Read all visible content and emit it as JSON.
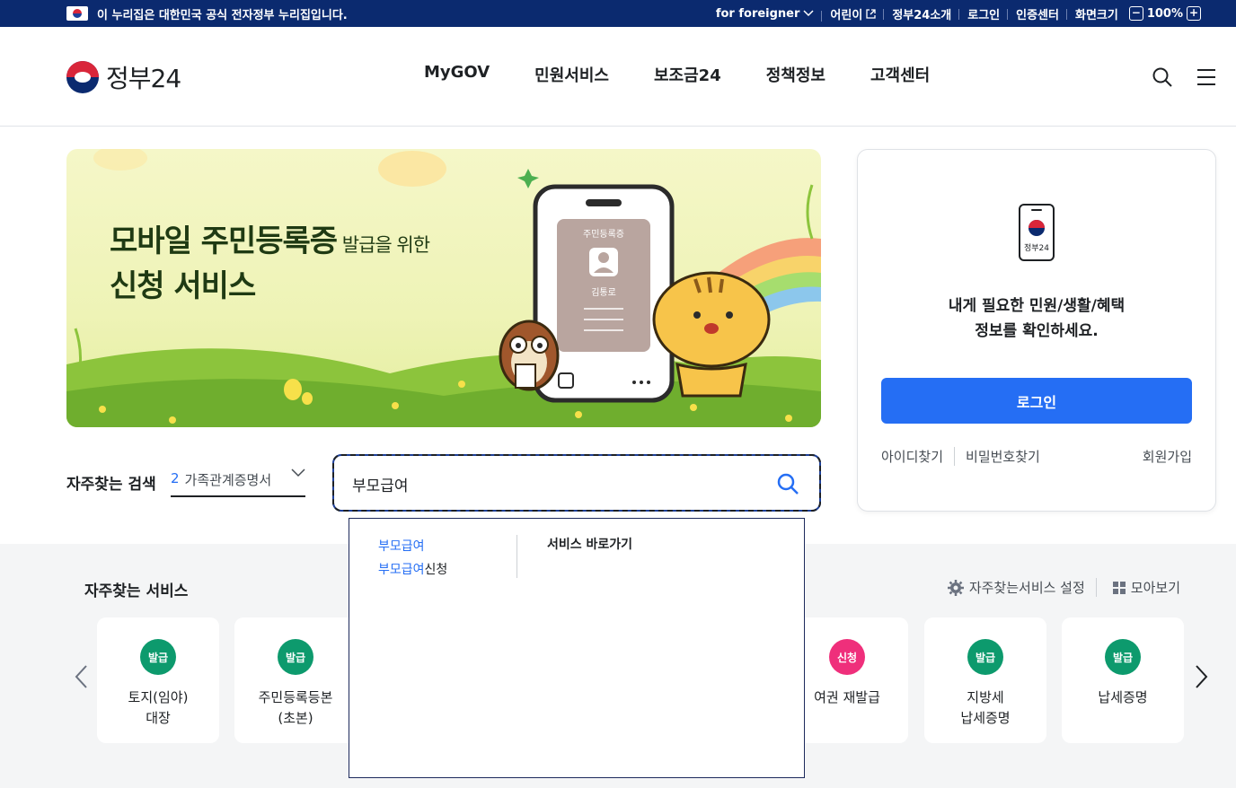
{
  "topbar": {
    "notice": "이 누리집은 대한민국 공식 전자정부 누리집입니다.",
    "links": [
      "for foreigner",
      "어린이",
      "정부24소개",
      "로그인",
      "인증센터",
      "화면크기"
    ],
    "zoom_minus": "−",
    "zoom_value": "100%",
    "zoom_plus": "+"
  },
  "header": {
    "logo_text": "정부24",
    "nav": [
      "MyGOV",
      "민원서비스",
      "보조금24",
      "정책정보",
      "고객센터"
    ],
    "icons": [
      "search-icon",
      "menu-icon"
    ]
  },
  "banner": {
    "title_line1": "모바일 주민등록증",
    "title_line1_small": " 발급을 위한",
    "title_line2": "신청 서비스",
    "card_label": "주민등록증",
    "card_name": "김통로"
  },
  "login": {
    "phone_label": "정부24",
    "message_line1": "내게 필요한 민원/생활/혜택",
    "message_line2": "정보를 확인하세요.",
    "button": "로그인",
    "find_id": "아이디찾기",
    "find_pw": "비밀번호찾기",
    "signup": "회원가입"
  },
  "search": {
    "freq_label": "자주찾는 검색",
    "freq_rank": "2",
    "freq_term": "가족관계증명서",
    "query": "부모급여"
  },
  "autocomplete": {
    "suggestions": [
      {
        "match": "부모급여",
        "rest": ""
      },
      {
        "match": "부모급여",
        "rest": "신청"
      }
    ],
    "shortcut_title": "서비스 바로가기"
  },
  "services": {
    "title": "자주찾는 서비스",
    "settings": "자주찾는서비스 설정",
    "view_all": "모아보기",
    "items": [
      {
        "badge": "발급",
        "name": "토지(임야)\n대장",
        "color": "#0d9a6d"
      },
      {
        "badge": "발급",
        "name": "주민등록등본\n(초본)",
        "color": "#0d9a6d"
      },
      {
        "badge": "신청",
        "name": "여권 재발급",
        "color": "#ef2f7b"
      },
      {
        "badge": "발급",
        "name": "지방세\n납세증명",
        "color": "#0d9a6d"
      },
      {
        "badge": "발급",
        "name": "납세증명",
        "color": "#0d9a6d"
      }
    ]
  },
  "colors": {
    "brand_navy": "#0b2a6f",
    "primary_blue": "#256ef4",
    "badge_green": "#0d9a6d",
    "badge_pink": "#ef2f7b"
  }
}
